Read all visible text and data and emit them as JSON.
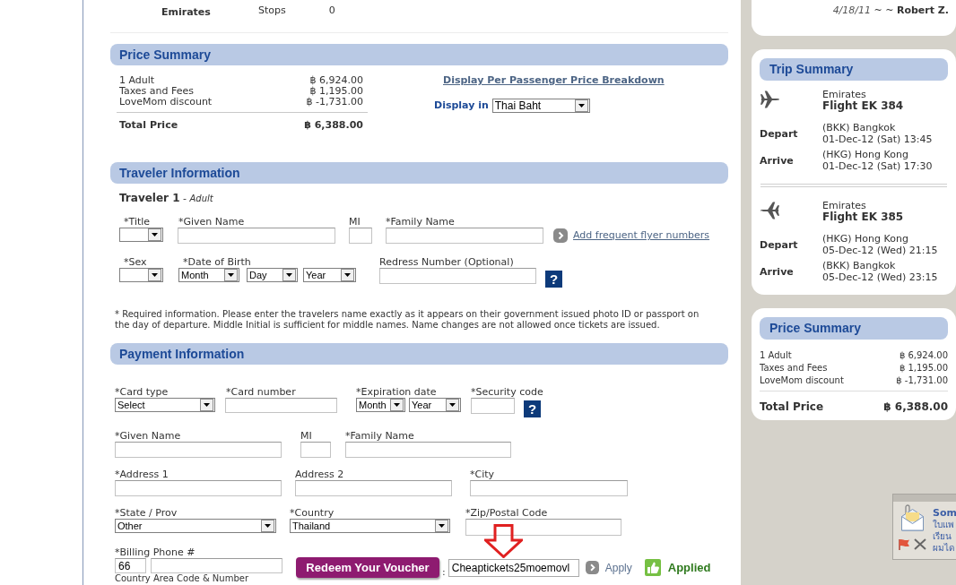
{
  "flight_details": {
    "airline": "Emirates",
    "stops_label": "Stops",
    "stops_value": "0"
  },
  "price_summary": {
    "title": "Price Summary",
    "rows": [
      {
        "label": "1 Adult",
        "amount": "฿ 6,924.00"
      },
      {
        "label": "Taxes and Fees",
        "amount": "฿ 1,195.00"
      },
      {
        "label": "LoveMom discount",
        "amount": "฿ -1,731.00"
      }
    ],
    "total": {
      "label": "Total Price",
      "amount": "฿ 6,388.00"
    },
    "breakdown_link": "Display Per Passenger Price Breakdown",
    "display_in": {
      "label": "Display in",
      "value": "Thai Baht"
    }
  },
  "traveler_information": {
    "title": "Traveler Information",
    "traveler_heading": "**Traveler 1** - *Adult*",
    "fields": [
      {
        "kind": "select",
        "label": "*Title"
      },
      {
        "kind": "input",
        "label": "*Given Name"
      },
      {
        "kind": "input",
        "label": "MI"
      },
      {
        "kind": "input",
        "label": "*Family Name"
      },
      {
        "kind": "select",
        "label": "*Sex"
      },
      {
        "kind": "select_group",
        "label": "*Date of Birth",
        "selects": [
          {
            "value": "Month"
          },
          {
            "value": "Day"
          },
          {
            "value": "Year"
          }
        ]
      },
      {
        "kind": "input",
        "label": "Redress Number (Optional)",
        "help": "?"
      }
    ],
    "frequent_flyer_link": "Add frequent flyer numbers",
    "note": "* Required information. Please enter the travelers name exactly as it appears on their government issued photo ID or passport on the day of departure. Middle Initial is sufficient for middle names. Name changes are not allowed once tickets are issued."
  },
  "payment_information": {
    "title": "Payment Information",
    "fields": [
      {
        "kind": "select",
        "label": "*Card type",
        "value": "Select"
      },
      {
        "kind": "input",
        "label": "*Card number"
      },
      {
        "kind": "select_group",
        "label": "*Expiration date",
        "selects": [
          {
            "value": "Month"
          },
          {
            "value": "Year"
          }
        ]
      },
      {
        "kind": "input",
        "label": "*Security code",
        "help": "?"
      },
      {
        "kind": "input",
        "label": "*Given Name"
      },
      {
        "kind": "input",
        "label": "MI"
      },
      {
        "kind": "input",
        "label": "*Family Name"
      },
      {
        "kind": "input",
        "label": "*Address 1"
      },
      {
        "kind": "input",
        "label": "Address 2"
      },
      {
        "kind": "input",
        "label": "*City"
      },
      {
        "kind": "select",
        "label": "*State / Prov",
        "value": "Other"
      },
      {
        "kind": "select",
        "label": "*Country",
        "value": "Thailand"
      },
      {
        "kind": "input",
        "label": "*Zip/Postal Code"
      },
      {
        "kind": "phone",
        "label": "*Billing Phone #",
        "country_code": "66",
        "hint": "Country Area Code & Number"
      },
      {
        "kind": "voucher",
        "button": "Redeem Your Voucher",
        "separator": ":",
        "code": "Cheaptickets25moemovl",
        "apply": "Apply",
        "status": "Applied"
      }
    ]
  },
  "sidebar": {
    "review_signature": "*4/18/11* ~ ~ **Robert Z.**",
    "trip_summary": {
      "title": "Trip Summary",
      "flights": [
        {
          "kind": "outbound",
          "airline": "Emirates",
          "flight": "Flight EK 384",
          "legs": [
            {
              "label": "Depart",
              "place": "(BKK) Bangkok",
              "time": "01-Dec-12 (Sat) 13:45"
            },
            {
              "label": "Arrive",
              "place": "(HKG) Hong Kong",
              "time": "01-Dec-12 (Sat) 17:30"
            }
          ]
        },
        {
          "kind": "return",
          "airline": "Emirates",
          "flight": "Flight EK 385",
          "legs": [
            {
              "label": "Depart",
              "place": "(HKG) Hong Kong",
              "time": "05-Dec-12 (Wed) 21:15"
            },
            {
              "label": "Arrive",
              "place": "(BKK) Bangkok",
              "time": "05-Dec-12 (Wed) 23:15"
            }
          ]
        }
      ]
    },
    "price_summary": {
      "title": "Price Summary",
      "rows": [
        {
          "label": "1 Adult",
          "amount": "฿ 6,924.00"
        },
        {
          "label": "Taxes and Fees",
          "amount": "฿ 1,195.00"
        },
        {
          "label": "LoveMom discount",
          "amount": "฿ -1,731.00"
        }
      ],
      "total": {
        "label": "Total Price",
        "amount": "฿ 6,388.00"
      }
    }
  },
  "notification": {
    "sender": "Som",
    "lines": [
      "ใบแพ",
      "เรียน",
      "ผมได"
    ]
  }
}
